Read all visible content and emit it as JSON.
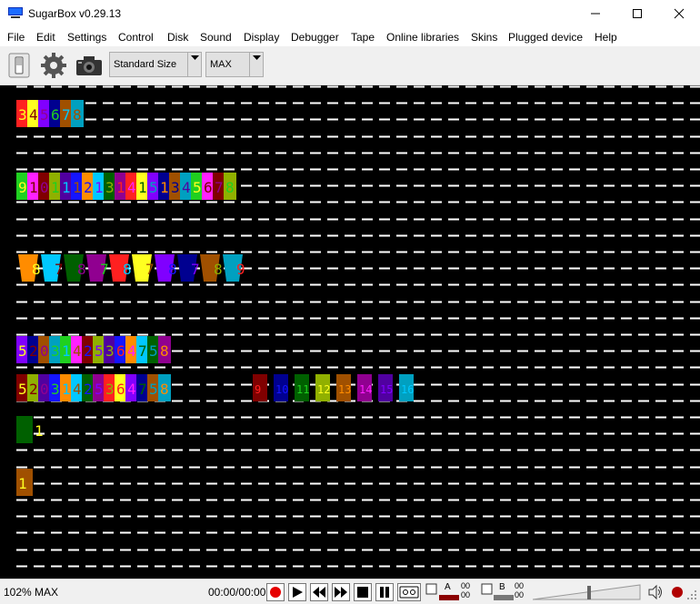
{
  "window": {
    "title": "SugarBox v0.29.13",
    "icon": "monitor-icon",
    "controls": [
      "minimize-icon",
      "maximize-icon",
      "close-icon"
    ]
  },
  "menu": [
    "File",
    "Edit",
    "Settings",
    "Control",
    "Disk",
    "Sound",
    "Display",
    "Debugger",
    "Tape",
    "Online libraries",
    "Skins",
    "Plugged device",
    "Help"
  ],
  "toolbar": {
    "buttons": [
      "power-switch-icon",
      "gear-icon",
      "camera-icon"
    ],
    "size_combo": "Standard Size",
    "speed_combo": "MAX"
  },
  "screen": {
    "rows": [
      {
        "text": "345678"
      },
      {
        "text": "91011121314151345678"
      },
      {
        "text": "8787878789"
      },
      {
        "text": "52031425364758"
      },
      {
        "text": "52031425364758",
        "extra": [
          "9",
          "10",
          "11",
          "12",
          "13",
          "14",
          "15",
          "16"
        ]
      },
      {
        "text": "1"
      },
      {
        "text": "1"
      }
    ]
  },
  "status": {
    "zoom": "102% MAX",
    "time": "00:00/00:00",
    "channel_a_label": "A",
    "channel_a_top": "00",
    "channel_a_bottom": "00",
    "channel_b_label": "B",
    "channel_b_top": "00",
    "channel_b_bottom": "00",
    "colors": {
      "record": "#e60000",
      "screen_bg": "#000000",
      "line": "#ffffff"
    }
  }
}
